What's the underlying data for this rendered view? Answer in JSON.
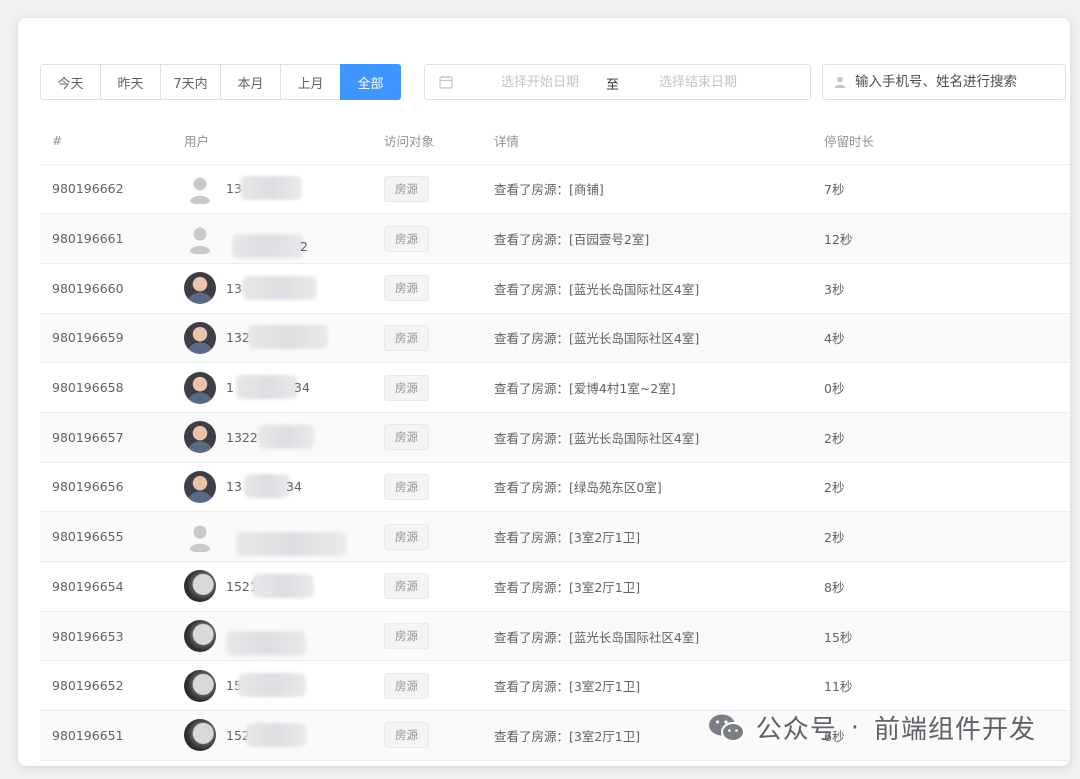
{
  "filters": {
    "ranges": [
      "今天",
      "昨天",
      "7天内",
      "本月",
      "上月",
      "全部"
    ],
    "active_index": 5
  },
  "date_range": {
    "start_placeholder": "选择开始日期",
    "separator": "至",
    "end_placeholder": "选择结束日期"
  },
  "search": {
    "placeholder": "输入手机号、姓名进行搜索"
  },
  "table": {
    "headers": [
      "#",
      "用户",
      "访问对象",
      "详情",
      "停留时长"
    ],
    "rows": [
      {
        "id": "980196662",
        "phone_prefix": "13",
        "phone_suffix": "",
        "avatar": "gray",
        "target": "房源",
        "detail": "查看了房源：[商铺]",
        "duration": "7秒"
      },
      {
        "id": "980196661",
        "phone_prefix": "",
        "phone_suffix": "2",
        "avatar": "gray",
        "target": "房源",
        "detail": "查看了房源：[百园壹号2室]",
        "duration": "12秒"
      },
      {
        "id": "980196660",
        "phone_prefix": "13",
        "phone_suffix": "",
        "avatar": "photo",
        "target": "房源",
        "detail": "查看了房源：[蓝光长岛国际社区4室]",
        "duration": "3秒"
      },
      {
        "id": "980196659",
        "phone_prefix": "132",
        "phone_suffix": "",
        "avatar": "photo",
        "target": "房源",
        "detail": "查看了房源：[蓝光长岛国际社区4室]",
        "duration": "4秒"
      },
      {
        "id": "980196658",
        "phone_prefix": "1",
        "phone_suffix": "34",
        "avatar": "photo",
        "target": "房源",
        "detail": "查看了房源：[爱博4村1室~2室]",
        "duration": "0秒"
      },
      {
        "id": "980196657",
        "phone_prefix": "1322",
        "phone_suffix": "",
        "avatar": "photo",
        "target": "房源",
        "detail": "查看了房源：[蓝光长岛国际社区4室]",
        "duration": "2秒"
      },
      {
        "id": "980196656",
        "phone_prefix": "13",
        "phone_suffix": "34",
        "avatar": "photo",
        "target": "房源",
        "detail": "查看了房源：[绿岛苑东区0室]",
        "duration": "2秒"
      },
      {
        "id": "980196655",
        "phone_prefix": "",
        "phone_suffix": "",
        "avatar": "gray",
        "target": "房源",
        "detail": "查看了房源：[3室2厅1卫]",
        "duration": "2秒"
      },
      {
        "id": "980196654",
        "phone_prefix": "1521",
        "phone_suffix": "",
        "avatar": "dark",
        "target": "房源",
        "detail": "查看了房源：[3室2厅1卫]",
        "duration": "8秒"
      },
      {
        "id": "980196653",
        "phone_prefix": "",
        "phone_suffix": "",
        "avatar": "dark",
        "target": "房源",
        "detail": "查看了房源：[蓝光长岛国际社区4室]",
        "duration": "15秒"
      },
      {
        "id": "980196652",
        "phone_prefix": "15",
        "phone_suffix": "",
        "avatar": "dark",
        "target": "房源",
        "detail": "查看了房源：[3室2厅1卫]",
        "duration": "11秒"
      },
      {
        "id": "980196651",
        "phone_prefix": "152",
        "phone_suffix": "",
        "avatar": "dark",
        "target": "房源",
        "detail": "查看了房源：[3室2厅1卫]",
        "duration": "6秒"
      }
    ]
  },
  "watermark": {
    "left": "公众号",
    "dot": "·",
    "right": "前端组件开发"
  },
  "colors": {
    "primary": "#4096ff",
    "border": "#dcdfe6",
    "header_text": "#909399",
    "text": "#606266"
  }
}
